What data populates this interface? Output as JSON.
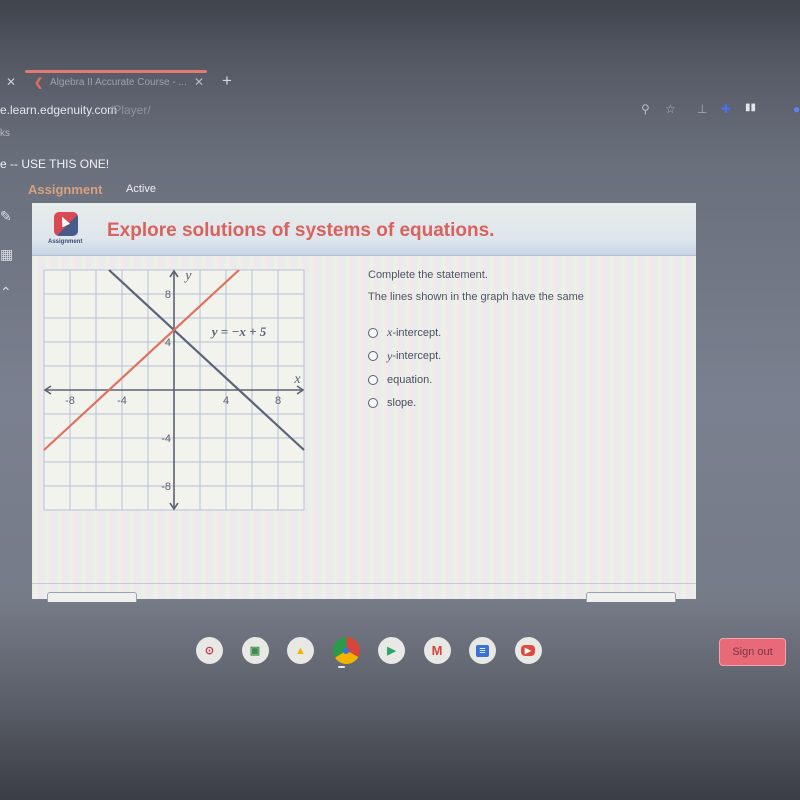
{
  "browser": {
    "tabs": [
      {
        "label": "Algebra II Accurate Course - ...",
        "active": true
      }
    ],
    "url_host": "e.learn.edgenuity.com",
    "url_path": "/Player/",
    "bookmarks_fragment": "ks",
    "extensions": [
      "location-icon",
      "star-icon",
      "extension-icon",
      "puzzle-icon",
      "reading-list-icon"
    ]
  },
  "course": {
    "title": "e -- USE THIS ONE!",
    "section_label": "Assignment",
    "section_status": "Active"
  },
  "sidebar_tools": [
    "pencil-icon",
    "calculator-icon",
    "highlighter-icon"
  ],
  "activity": {
    "badge_label": "Assignment",
    "title": "Explore solutions of systems of equations.",
    "question": {
      "prompt": "Complete the statement.",
      "stem": "The lines shown in the graph have the same",
      "options": [
        {
          "var": "x",
          "text": "-intercept."
        },
        {
          "var": "y",
          "text": "-intercept."
        },
        {
          "var": "",
          "text": "equation."
        },
        {
          "var": "",
          "text": "slope."
        }
      ]
    }
  },
  "chart_data": {
    "type": "line",
    "title": "",
    "xlabel": "x",
    "ylabel": "y",
    "xlim": [
      -10,
      10
    ],
    "ylim": [
      -10,
      10
    ],
    "grid": true,
    "grid_step": 2,
    "x_ticks": [
      -8,
      -4,
      4,
      8
    ],
    "y_ticks": [
      8,
      4,
      -4,
      -8
    ],
    "series": [
      {
        "name": "y = -x + 5",
        "slope": -1,
        "intercept": 5,
        "color": "#5b6478",
        "labeled": true
      },
      {
        "name": "y = x + 5",
        "slope": 1,
        "intercept": 5,
        "color": "#e0705f",
        "labeled": false
      }
    ],
    "annotations": [
      {
        "text": "y = −x + 5",
        "x": 5,
        "y": 4.5
      }
    ]
  },
  "shelf": {
    "apps": [
      {
        "name": "app-launcher",
        "glyph": "⊙",
        "color": "#c23a5a"
      },
      {
        "name": "classroom",
        "glyph": "▣",
        "color": "#3d8a4a"
      },
      {
        "name": "drive",
        "glyph": "▲",
        "color": "#f2b400"
      },
      {
        "name": "chrome",
        "glyph": "●",
        "color": "#3a72d8"
      },
      {
        "name": "play-store",
        "glyph": "▶",
        "color": "#2aa56b"
      },
      {
        "name": "gmail",
        "glyph": "M",
        "color": "#d6453a"
      },
      {
        "name": "docs",
        "glyph": "≡",
        "color": "#3a72d8"
      },
      {
        "name": "youtube",
        "glyph": "▶",
        "color": "#ffffff"
      }
    ],
    "signout_label": "Sign out"
  },
  "colors": {
    "title_red": "#d9625c",
    "assignment_orange": "#d8a07f"
  }
}
